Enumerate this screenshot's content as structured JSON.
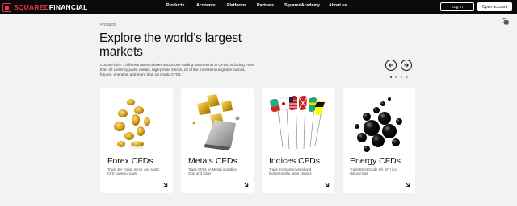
{
  "brand": {
    "name_accent": "SQUARED",
    "name_rest": "FINANCIAL"
  },
  "nav": {
    "items": [
      {
        "label": "Products"
      },
      {
        "label": "Accounts"
      },
      {
        "label": "Platforms"
      },
      {
        "label": "Partners"
      },
      {
        "label": "SquaredAcademy"
      },
      {
        "label": "About us"
      }
    ],
    "login_label": "Log in",
    "open_account_label": "Open account"
  },
  "header": {
    "breadcrumb": "Products",
    "title": "Explore the world's largest markets",
    "description": "Choose from 7 different asset classes and 2000+ trading instruments in CFDs, including more than 40 currency pairs, metals, high-profile stocks, 15 of the most famous global indices, futures, energies, and more than 10 crypto CFDs."
  },
  "carousel": {
    "dots": 4,
    "active_index": 0
  },
  "cards": [
    {
      "title": "Forex CFDs",
      "description": "Trade 40+ major, minor, and exotic CFD currency pairs",
      "image": "gold-coins"
    },
    {
      "title": "Metals CFDs",
      "description": "Trade CFDs on Metals including Gold and Silver",
      "image": "gold-bars"
    },
    {
      "title": "Indices CFDs",
      "description": "Trade the most covered and highest-profile asset classes",
      "image": "flags"
    },
    {
      "title": "Energy CFDs",
      "description": "Trade Brent Crude Oil, WTI and Natural Gas",
      "image": "oil-drops"
    }
  ],
  "colors": {
    "accent": "#e8344e",
    "navbar": "#0a0a0a",
    "background": "#f2f2f2",
    "gold": "#d4a017"
  }
}
